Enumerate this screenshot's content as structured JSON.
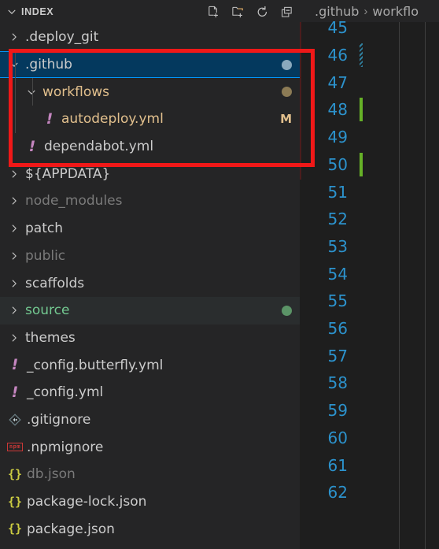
{
  "sidebar": {
    "title": "INDEX",
    "collapse_chevron_icon": "chevron-down-icon",
    "actions": [
      {
        "name": "new-file",
        "icon": "new-file-icon",
        "label": "New File..."
      },
      {
        "name": "new-folder",
        "icon": "new-folder-icon",
        "label": "New Folder..."
      },
      {
        "name": "refresh",
        "icon": "refresh-icon",
        "label": "Refresh Explorer"
      },
      {
        "name": "collapse-all",
        "icon": "collapse-all-icon",
        "label": "Collapse Folders in Explorer"
      }
    ],
    "tree": [
      {
        "name": ".deploy_git",
        "type": "folder",
        "expanded": false,
        "indent": 0,
        "state": "normal",
        "badge": "",
        "badge_color": ""
      },
      {
        "name": ".github",
        "type": "folder",
        "expanded": true,
        "indent": 0,
        "state": "selected",
        "badge": "dot",
        "badge_color": "#8aa9bd"
      },
      {
        "name": "workflows",
        "type": "folder",
        "expanded": true,
        "indent": 1,
        "state": "modified",
        "badge": "dot",
        "badge_color": "#8c7b55"
      },
      {
        "name": "autodeploy.yml",
        "type": "yml",
        "expanded": false,
        "indent": 2,
        "state": "modified",
        "badge": "M",
        "badge_color": "#e2c08d"
      },
      {
        "name": "dependabot.yml",
        "type": "yml",
        "expanded": false,
        "indent": 1,
        "state": "normal",
        "badge": "",
        "badge_color": ""
      },
      {
        "name": "${APPDATA}",
        "type": "folder",
        "expanded": false,
        "indent": 0,
        "state": "normal",
        "badge": "",
        "badge_color": ""
      },
      {
        "name": "node_modules",
        "type": "folder",
        "expanded": false,
        "indent": 0,
        "state": "ignored",
        "badge": "",
        "badge_color": ""
      },
      {
        "name": "patch",
        "type": "folder",
        "expanded": false,
        "indent": 0,
        "state": "normal",
        "badge": "",
        "badge_color": ""
      },
      {
        "name": "public",
        "type": "folder",
        "expanded": false,
        "indent": 0,
        "state": "ignored",
        "badge": "",
        "badge_color": ""
      },
      {
        "name": "scaffolds",
        "type": "folder",
        "expanded": false,
        "indent": 0,
        "state": "normal",
        "badge": "",
        "badge_color": ""
      },
      {
        "name": "source",
        "type": "folder",
        "expanded": false,
        "indent": 0,
        "state": "untracked",
        "badge": "dot",
        "badge_color": "#5b9467"
      },
      {
        "name": "themes",
        "type": "folder",
        "expanded": false,
        "indent": 0,
        "state": "normal",
        "badge": "",
        "badge_color": ""
      },
      {
        "name": "_config.butterfly.yml",
        "type": "yml",
        "expanded": false,
        "indent": 0,
        "state": "normal",
        "badge": "",
        "badge_color": ""
      },
      {
        "name": "_config.yml",
        "type": "yml",
        "expanded": false,
        "indent": 0,
        "state": "normal",
        "badge": "",
        "badge_color": ""
      },
      {
        "name": ".gitignore",
        "type": "git",
        "expanded": false,
        "indent": 0,
        "state": "normal",
        "badge": "",
        "badge_color": ""
      },
      {
        "name": ".npmignore",
        "type": "npm",
        "expanded": false,
        "indent": 0,
        "state": "normal",
        "badge": "",
        "badge_color": ""
      },
      {
        "name": "db.json",
        "type": "json",
        "expanded": false,
        "indent": 0,
        "state": "ignored",
        "badge": "",
        "badge_color": ""
      },
      {
        "name": "package-lock.json",
        "type": "json",
        "expanded": false,
        "indent": 0,
        "state": "normal",
        "badge": "",
        "badge_color": ""
      },
      {
        "name": "package.json",
        "type": "json",
        "expanded": false,
        "indent": 0,
        "state": "normal",
        "badge": "",
        "badge_color": ""
      }
    ]
  },
  "editor": {
    "breadcrumb": {
      "items": [
        ".github",
        "workflo"
      ],
      "separator": "›"
    },
    "lines": [
      {
        "number": "45",
        "gutter": ""
      },
      {
        "number": "46",
        "gutter": "modified"
      },
      {
        "number": "47",
        "gutter": ""
      },
      {
        "number": "48",
        "gutter": "added"
      },
      {
        "number": "49",
        "gutter": ""
      },
      {
        "number": "50",
        "gutter": "added"
      },
      {
        "number": "51",
        "gutter": ""
      },
      {
        "number": "52",
        "gutter": ""
      },
      {
        "number": "53",
        "gutter": ""
      },
      {
        "number": "54",
        "gutter": ""
      },
      {
        "number": "55",
        "gutter": ""
      },
      {
        "number": "56",
        "gutter": ""
      },
      {
        "number": "57",
        "gutter": ""
      },
      {
        "number": "58",
        "gutter": ""
      },
      {
        "number": "59",
        "gutter": ""
      },
      {
        "number": "60",
        "gutter": ""
      },
      {
        "number": "61",
        "gutter": ""
      },
      {
        "number": "62",
        "gutter": ""
      }
    ]
  },
  "annotation": {
    "highlight_color": "#f01818",
    "shape": "rectangle"
  },
  "colors": {
    "sidebar_background": "#252526",
    "editor_background": "#1e1e1e",
    "selection_background": "#04395e",
    "selection_border": "#0097fb",
    "hover_background": "#2a2d2e",
    "line_number": "#2c92cc",
    "modified_text": "#e2c08d",
    "untracked_text": "#73c991",
    "ignored_text": "#7a7a7a",
    "yml_icon": "#c586c0",
    "json_icon": "#cbcb41",
    "npm_icon": "#cb3837",
    "diff_added": "#66b127"
  }
}
